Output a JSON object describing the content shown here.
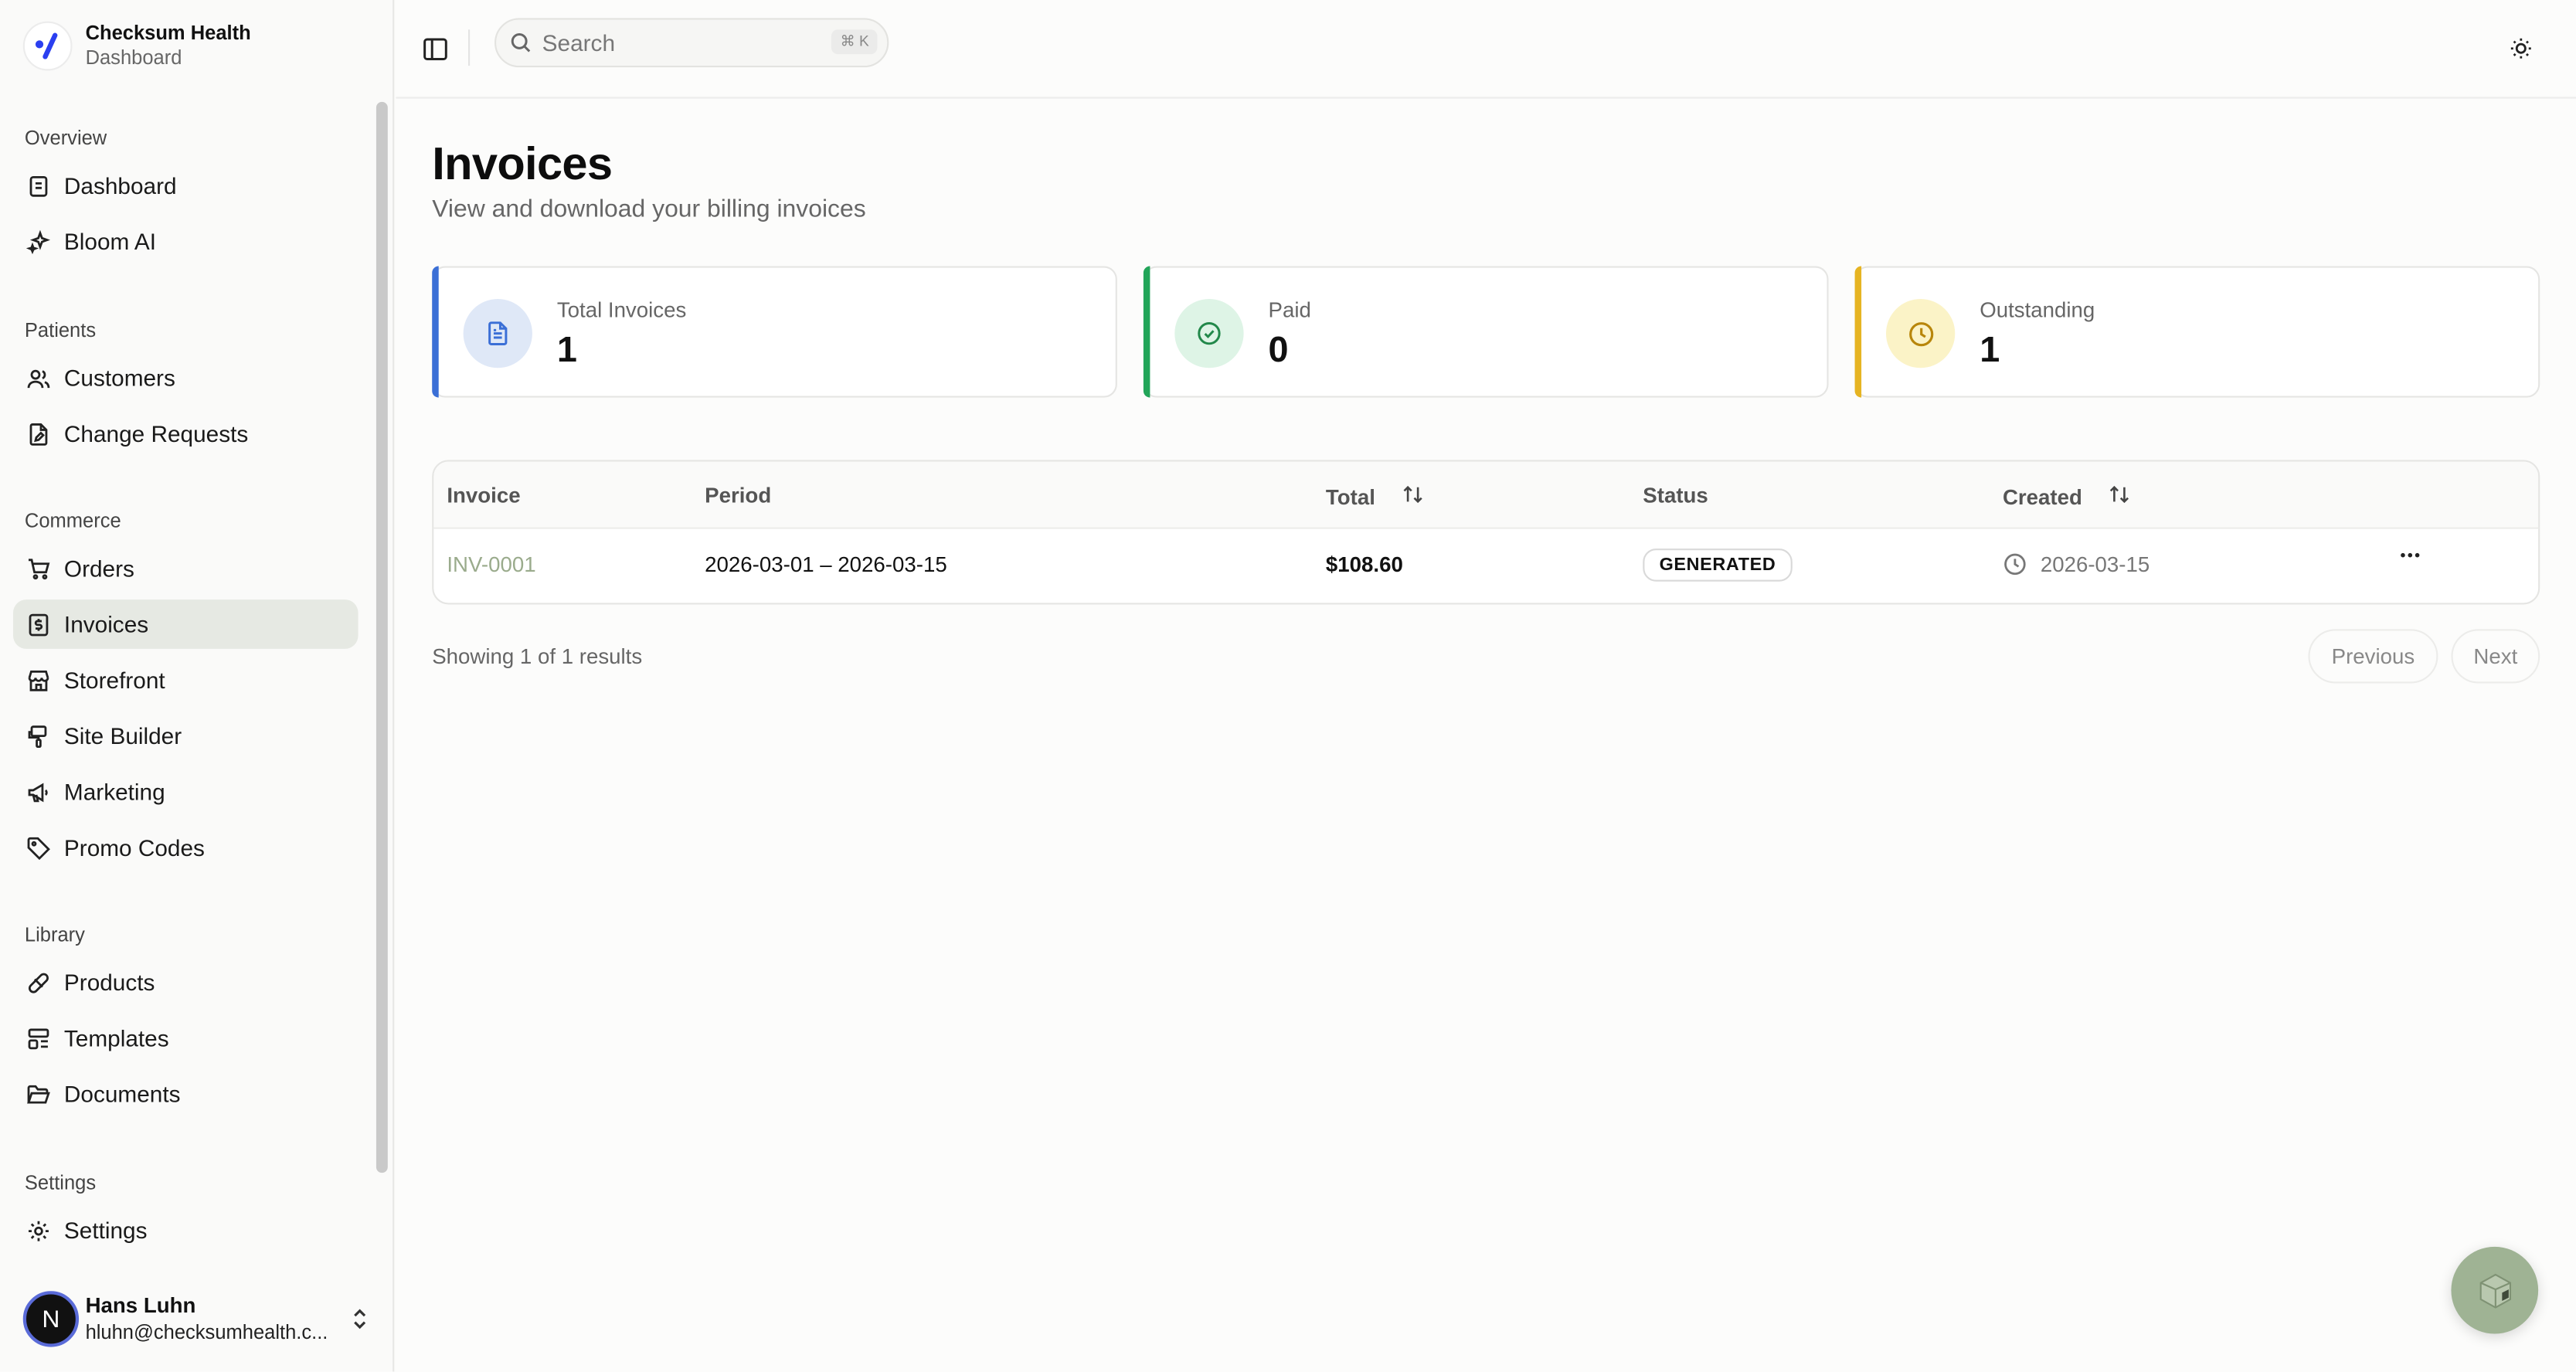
{
  "brand": {
    "name": "Checksum Health",
    "subtitle": "Dashboard"
  },
  "sidebar": {
    "groups": [
      {
        "label": "Overview",
        "items": [
          {
            "label": "Dashboard",
            "icon": "dashboard-icon"
          },
          {
            "label": "Bloom AI",
            "icon": "sparkles-icon"
          }
        ]
      },
      {
        "label": "Patients",
        "items": [
          {
            "label": "Customers",
            "icon": "users-icon"
          },
          {
            "label": "Change Requests",
            "icon": "file-edit-icon"
          }
        ]
      },
      {
        "label": "Commerce",
        "items": [
          {
            "label": "Orders",
            "icon": "cart-icon"
          },
          {
            "label": "Invoices",
            "icon": "invoice-icon",
            "active": true
          },
          {
            "label": "Storefront",
            "icon": "store-icon"
          },
          {
            "label": "Site Builder",
            "icon": "paint-icon"
          },
          {
            "label": "Marketing",
            "icon": "megaphone-icon"
          },
          {
            "label": "Promo Codes",
            "icon": "tag-icon"
          }
        ]
      },
      {
        "label": "Library",
        "items": [
          {
            "label": "Products",
            "icon": "pill-icon"
          },
          {
            "label": "Templates",
            "icon": "layout-icon"
          },
          {
            "label": "Documents",
            "icon": "folder-icon"
          }
        ]
      },
      {
        "label": "Settings",
        "items": [
          {
            "label": "Settings",
            "icon": "gear-icon"
          }
        ]
      }
    ],
    "user": {
      "initial": "N",
      "name": "Hans Luhn",
      "email": "hluhn@checksumhealth.c..."
    }
  },
  "header": {
    "search_placeholder": "Search",
    "shortcut": "⌘ K"
  },
  "page": {
    "title": "Invoices",
    "subtitle": "View and download your billing invoices"
  },
  "stats": [
    {
      "label": "Total Invoices",
      "value": "1",
      "accent": "#3b6fd6",
      "icon": "document-icon"
    },
    {
      "label": "Paid",
      "value": "0",
      "accent": "#22a559",
      "icon": "check-circle-icon"
    },
    {
      "label": "Outstanding",
      "value": "1",
      "accent": "#e6b422",
      "icon": "clock-icon"
    }
  ],
  "table": {
    "columns": {
      "invoice": "Invoice",
      "period": "Period",
      "total": "Total",
      "status": "Status",
      "created": "Created"
    },
    "rows": [
      {
        "invoice": "INV-0001",
        "period": "2026-03-01 – 2026-03-15",
        "total": "$108.60",
        "status": "GENERATED",
        "created": "2026-03-15"
      }
    ]
  },
  "pagination": {
    "summary": "Showing 1 of 1 results",
    "previous": "Previous",
    "next": "Next"
  }
}
